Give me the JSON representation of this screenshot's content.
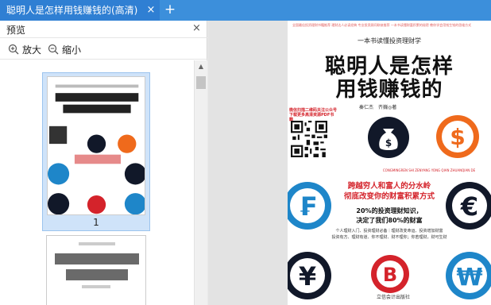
{
  "tab": {
    "title": "聪明人是怎样用钱赚钱的(高清)",
    "close_glyph": "×",
    "add_glyph": "+"
  },
  "sidebar": {
    "title": "预览",
    "close_glyph": "×",
    "zoom_in_label": "放大",
    "zoom_out_label": "缩小",
    "thumbnails": [
      {
        "page_number": "1"
      }
    ]
  },
  "cover": {
    "fine_print": "全国最佳投资理财书籍推荐 理财达人必读经典 专业投资顾问联袂推荐 一本书读懂财富积累的秘密 教你学会用钱生钱的思维方式",
    "subtitle": "一本书读懂投资理财学",
    "title_line1": "聪明人是怎样",
    "title_line2": "用钱赚钱的",
    "authors": "秦仁杰　齐巍◎著",
    "scan_text": "微信扫描二维码关注公众号 下载更多高清资源PDF书籍",
    "pinyin": "CONGMINGREN SHI ZENYANG YONG QIAN ZHUANQIAN DE",
    "tagline1": "跨越穷人和富人的分水岭",
    "tagline2": "彻底改变你的财富积累方式",
    "line1": "20%的投资理财知识，",
    "line2": "决定了我们80%的财富",
    "small_a": "个人理财入门、投资理财必备｜理财改变命运、投资增加财富",
    "small_b": "投资有方、理财有道、你不理财、财不理你；你若理财，财可生财",
    "publisher": "立信会计出版社"
  },
  "colors": {
    "tab_bg": "#2f7fd3",
    "tabbar_bg": "#3c8fdb",
    "selected_thumb_bg": "#cfe3f9",
    "accent_red": "#d4232b",
    "orange": "#ef6a1c",
    "coin_blue": "#1e86c9",
    "dark_navy": "#111829"
  }
}
